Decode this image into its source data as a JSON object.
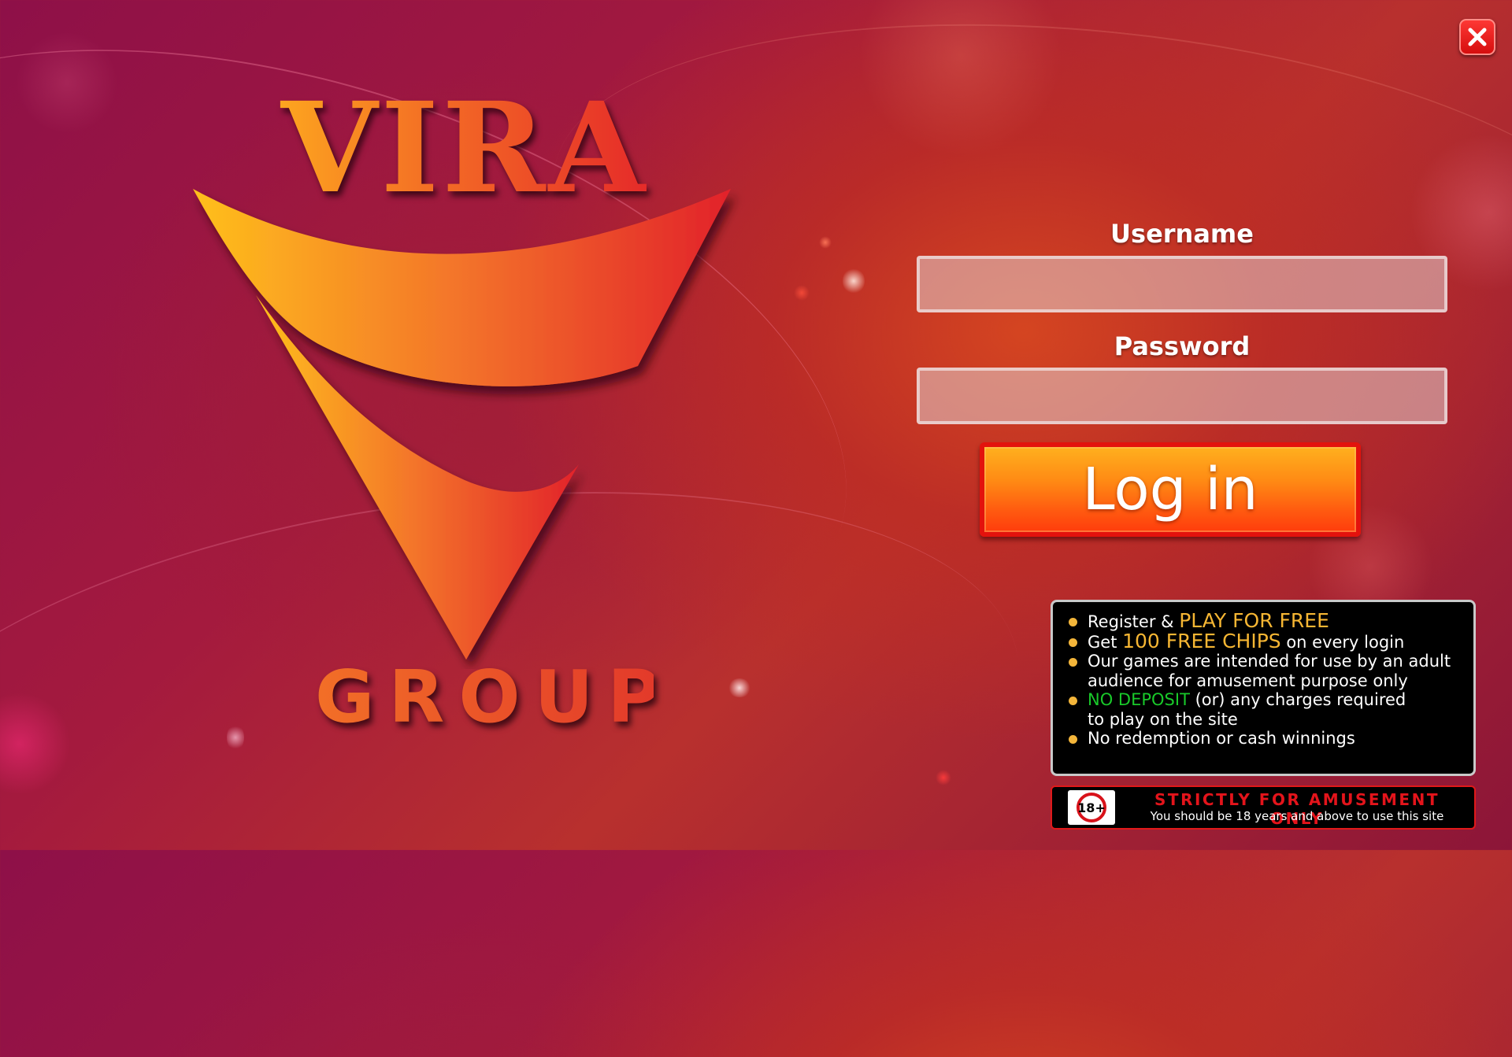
{
  "window": {
    "close_icon": "close-icon",
    "close_color": "#e3120d"
  },
  "logo": {
    "top_text": "VIRA",
    "bottom_text": "GROUP",
    "gradient_start": "#ffb21e",
    "gradient_end": "#e31f2a"
  },
  "login_form": {
    "username_label": "Username",
    "username_value": "",
    "password_label": "Password",
    "password_value": "",
    "login_button_label": "Log in"
  },
  "info_box": {
    "items": [
      {
        "prefix": "Register & ",
        "highlight": "PLAY FOR FREE",
        "suffix": ""
      },
      {
        "prefix": "Get ",
        "highlight": "100 FREE CHIPS",
        "suffix": " on every login"
      },
      {
        "line1": "Our games are intended for use by an adult",
        "line2": "audience for amusement purpose only"
      },
      {
        "highlight": "NO DEPOSIT",
        "suffix": " (or) any charges required",
        "line2": "to play on the site"
      },
      {
        "text": "No redemption or cash winnings"
      }
    ],
    "bullet_color": "#f3b53a",
    "highlight_color": "#f6b633",
    "green_color": "#19c92a"
  },
  "age_notice": {
    "badge": "18+",
    "title": "STRICTLY FOR AMUSEMENT ONLY",
    "subtitle": "You should be 18 years and above to use this site"
  }
}
